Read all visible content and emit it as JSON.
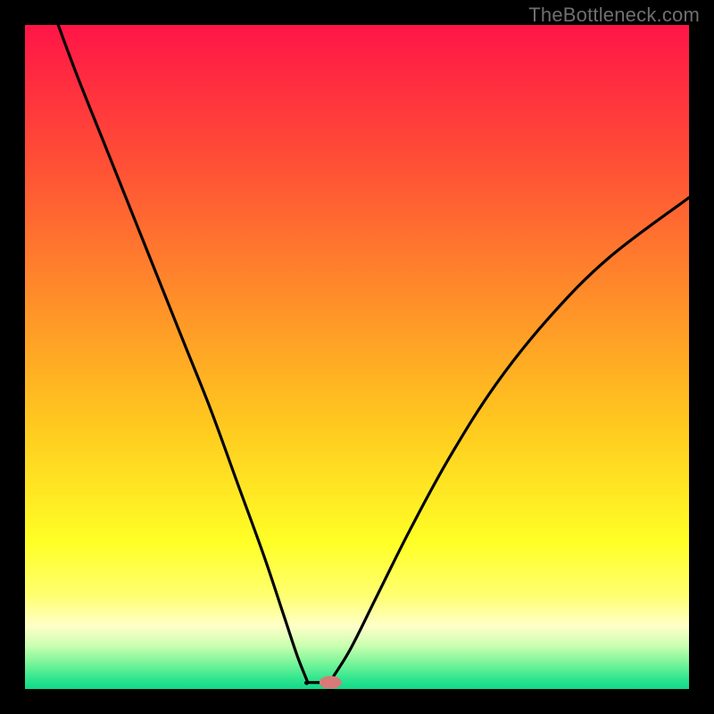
{
  "attribution": "TheBottleneck.com",
  "colors": {
    "frame": "#000000",
    "gradient_stops": [
      {
        "offset": 0.0,
        "color": "#ff1547"
      },
      {
        "offset": 0.2,
        "color": "#ff4d36"
      },
      {
        "offset": 0.4,
        "color": "#ff8a2a"
      },
      {
        "offset": 0.6,
        "color": "#ffc81f"
      },
      {
        "offset": 0.78,
        "color": "#ffff26"
      },
      {
        "offset": 0.86,
        "color": "#ffff72"
      },
      {
        "offset": 0.905,
        "color": "#ffffc8"
      },
      {
        "offset": 0.935,
        "color": "#c9ffb0"
      },
      {
        "offset": 0.96,
        "color": "#7cf59a"
      },
      {
        "offset": 0.985,
        "color": "#2fe58e"
      },
      {
        "offset": 1.0,
        "color": "#11d889"
      }
    ],
    "curve": "#000000",
    "marker_fill": "#d87a78",
    "marker_stroke": "#d87a78"
  },
  "chart_data": {
    "type": "line",
    "title": "",
    "xlabel": "",
    "ylabel": "",
    "xlim": [
      0,
      100
    ],
    "ylim": [
      0,
      100
    ],
    "axes_visible": false,
    "grid": false,
    "description": "Bottleneck-style V curve: steep descent from top-left, floor near x≈43, rise to upper-right. Background vertical gradient red→green. Single marker at the minimum.",
    "series": [
      {
        "name": "bottleneck-curve",
        "segment": "left",
        "x": [
          5.0,
          8.0,
          12.0,
          16.0,
          20.0,
          24.0,
          28.0,
          32.0,
          36.0,
          39.0,
          41.0,
          42.5
        ],
        "y": [
          100.0,
          92.0,
          82.0,
          72.0,
          62.0,
          52.0,
          42.0,
          31.0,
          20.0,
          11.0,
          5.0,
          1.2
        ]
      },
      {
        "name": "bottleneck-curve",
        "segment": "floor",
        "x": [
          42.5,
          46.0
        ],
        "y": [
          1.0,
          1.0
        ]
      },
      {
        "name": "bottleneck-curve",
        "segment": "right",
        "x": [
          46.0,
          49.0,
          53.0,
          58.0,
          64.0,
          71.0,
          79.0,
          88.0,
          100.0
        ],
        "y": [
          1.2,
          6.0,
          14.0,
          24.0,
          35.0,
          46.0,
          56.0,
          65.0,
          74.0
        ]
      }
    ],
    "marker": {
      "x": 46.0,
      "y": 1.0,
      "shape": "pill",
      "rx": 1.6,
      "ry": 0.9
    }
  }
}
